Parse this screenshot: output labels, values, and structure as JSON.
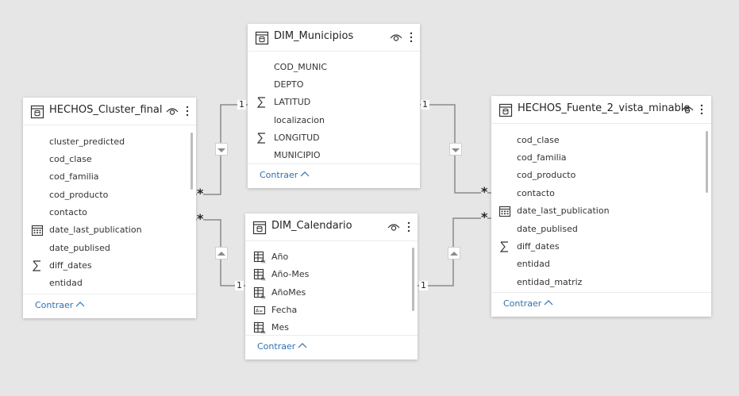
{
  "tables": {
    "municipios": {
      "title": "DIM_Municipios",
      "fields": [
        {
          "name": "COD_MUNIC",
          "icon": ""
        },
        {
          "name": "DEPTO",
          "icon": ""
        },
        {
          "name": "LATITUD",
          "icon": "sigma-icon"
        },
        {
          "name": "localizacion",
          "icon": ""
        },
        {
          "name": "LONGITUD",
          "icon": "sigma-icon"
        },
        {
          "name": "MUNICIPIO",
          "icon": ""
        }
      ],
      "collapse_label": "Contraer"
    },
    "cluster": {
      "title": "HECHOS_Cluster_final",
      "fields": [
        {
          "name": "cluster_predicted",
          "icon": ""
        },
        {
          "name": "cod_clase",
          "icon": ""
        },
        {
          "name": "cod_familia",
          "icon": ""
        },
        {
          "name": "cod_producto",
          "icon": ""
        },
        {
          "name": "contacto",
          "icon": ""
        },
        {
          "name": "date_last_publication",
          "icon": "calendar-icon"
        },
        {
          "name": "date_publised",
          "icon": ""
        },
        {
          "name": "diff_dates",
          "icon": "sigma-icon"
        },
        {
          "name": "entidad",
          "icon": ""
        }
      ],
      "collapse_label": "Contraer"
    },
    "calendario": {
      "title": "DIM_Calendario",
      "fields": [
        {
          "name": "Año",
          "icon": "calc-column-icon"
        },
        {
          "name": "Año-Mes",
          "icon": "calc-column-icon"
        },
        {
          "name": "AñoMes",
          "icon": "calc-column-icon"
        },
        {
          "name": "Fecha",
          "icon": "calc-text-icon"
        },
        {
          "name": "Mes",
          "icon": "calc-column-icon"
        }
      ],
      "collapse_label": "Contraer"
    },
    "fuente": {
      "title": "HECHOS_Fuente_2_vista_minable",
      "fields": [
        {
          "name": "cod_clase",
          "icon": ""
        },
        {
          "name": "cod_familia",
          "icon": ""
        },
        {
          "name": "cod_producto",
          "icon": ""
        },
        {
          "name": "contacto",
          "icon": ""
        },
        {
          "name": "date_last_publication",
          "icon": "calendar-icon"
        },
        {
          "name": "date_publised",
          "icon": ""
        },
        {
          "name": "diff_dates",
          "icon": "sigma-icon"
        },
        {
          "name": "entidad",
          "icon": ""
        },
        {
          "name": "entidad_matriz",
          "icon": ""
        }
      ],
      "collapse_label": "Contraer"
    }
  },
  "relationships": {
    "cluster_municipios": {
      "one": "1",
      "many": "*"
    },
    "cluster_calendario": {
      "one": "1",
      "many": "*"
    },
    "fuente_municipios": {
      "one": "1",
      "many": "*"
    },
    "fuente_calendario": {
      "one": "1",
      "many": "*"
    }
  },
  "colors": {
    "canvas": "#e6e6e6",
    "line": "#8a8a8a",
    "link": "#2f6fb3"
  }
}
